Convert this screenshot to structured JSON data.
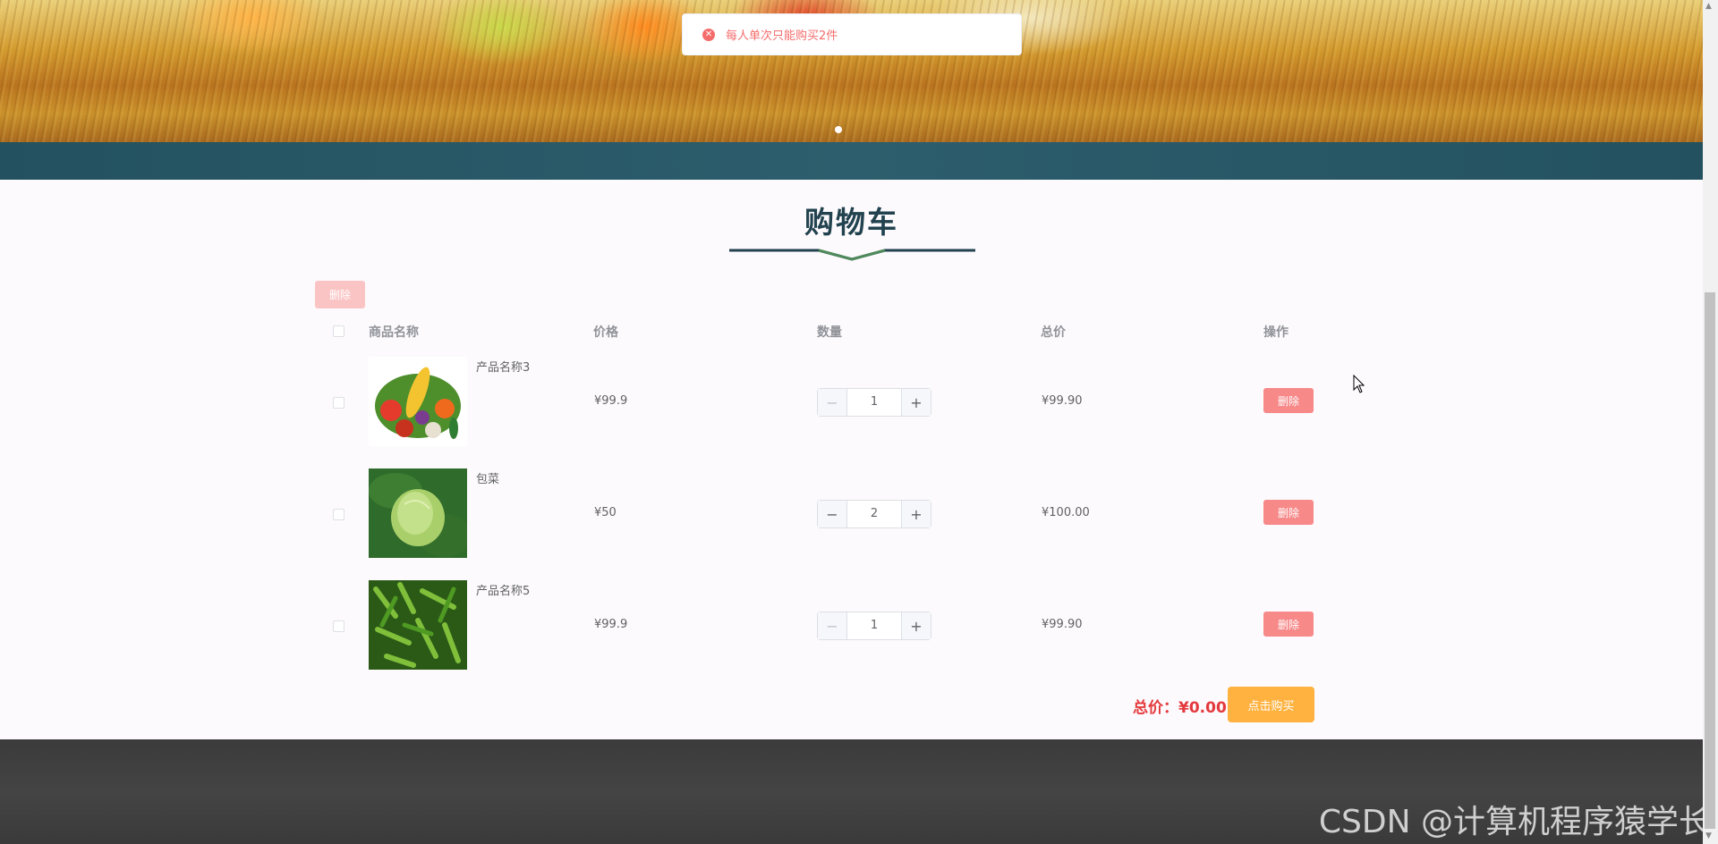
{
  "toast": {
    "message": "每人单次只能购买2件",
    "icon": "error-circle-icon"
  },
  "section": {
    "title": "购物车"
  },
  "toolbar": {
    "batch_delete_label": "删除"
  },
  "table": {
    "headers": {
      "name": "商品名称",
      "price": "价格",
      "quantity": "数量",
      "total": "总价",
      "action": "操作"
    },
    "rows": [
      {
        "name": "产品名称3",
        "price": "¥99.9",
        "quantity": "1",
        "subtotal": "¥99.90",
        "delete_label": "删除",
        "image": "mixed-vegetables-image"
      },
      {
        "name": "包菜",
        "price": "¥50",
        "quantity": "2",
        "subtotal": "¥100.00",
        "delete_label": "删除",
        "image": "cabbage-image"
      },
      {
        "name": "产品名称5",
        "price": "¥99.9",
        "quantity": "1",
        "subtotal": "¥99.90",
        "delete_label": "删除",
        "image": "green-peppers-image"
      }
    ]
  },
  "summary": {
    "total_label": "总价：¥0.00",
    "buy_label": "点击购买"
  },
  "watermark": "CSDN @计算机程序猿学长",
  "colors": {
    "accent": "#21424e",
    "danger": "#f78989",
    "buy": "#ffb240",
    "total": "#e4393c"
  }
}
